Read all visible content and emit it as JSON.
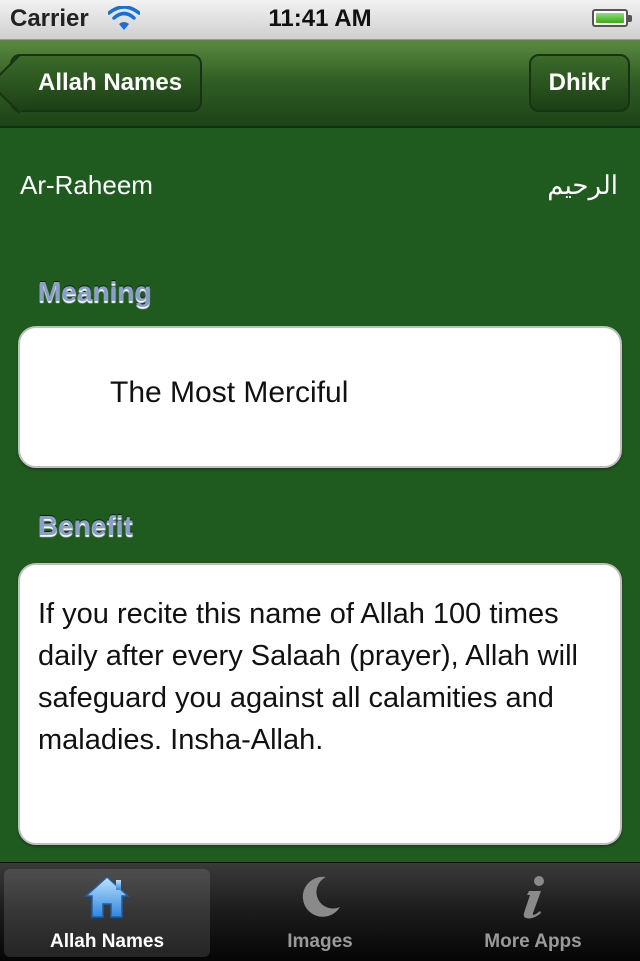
{
  "status_bar": {
    "carrier": "Carrier",
    "time": "11:41 AM"
  },
  "nav": {
    "back_label": "Allah Names",
    "right_label": "Dhikr"
  },
  "name": {
    "latin": "Ar-Raheem",
    "arabic": "الرحيم"
  },
  "meaning": {
    "label": "Meaning",
    "text": "The Most Merciful"
  },
  "benefit": {
    "label": "Benefit",
    "text": "If you recite this name of Allah 100 times daily after every Salaah (prayer), Allah will safeguard you against all calamities and maladies. Insha-Allah."
  },
  "tabs": [
    {
      "label": "Allah Names",
      "icon": "house-icon",
      "active": true
    },
    {
      "label": "Images",
      "icon": "crescent-moon-icon",
      "active": false
    },
    {
      "label": "More Apps",
      "icon": "info-icon",
      "active": false
    }
  ],
  "colors": {
    "background": "#1f5a1f",
    "nav": "#2f5c22",
    "accent_active": "#5aaaf0"
  }
}
